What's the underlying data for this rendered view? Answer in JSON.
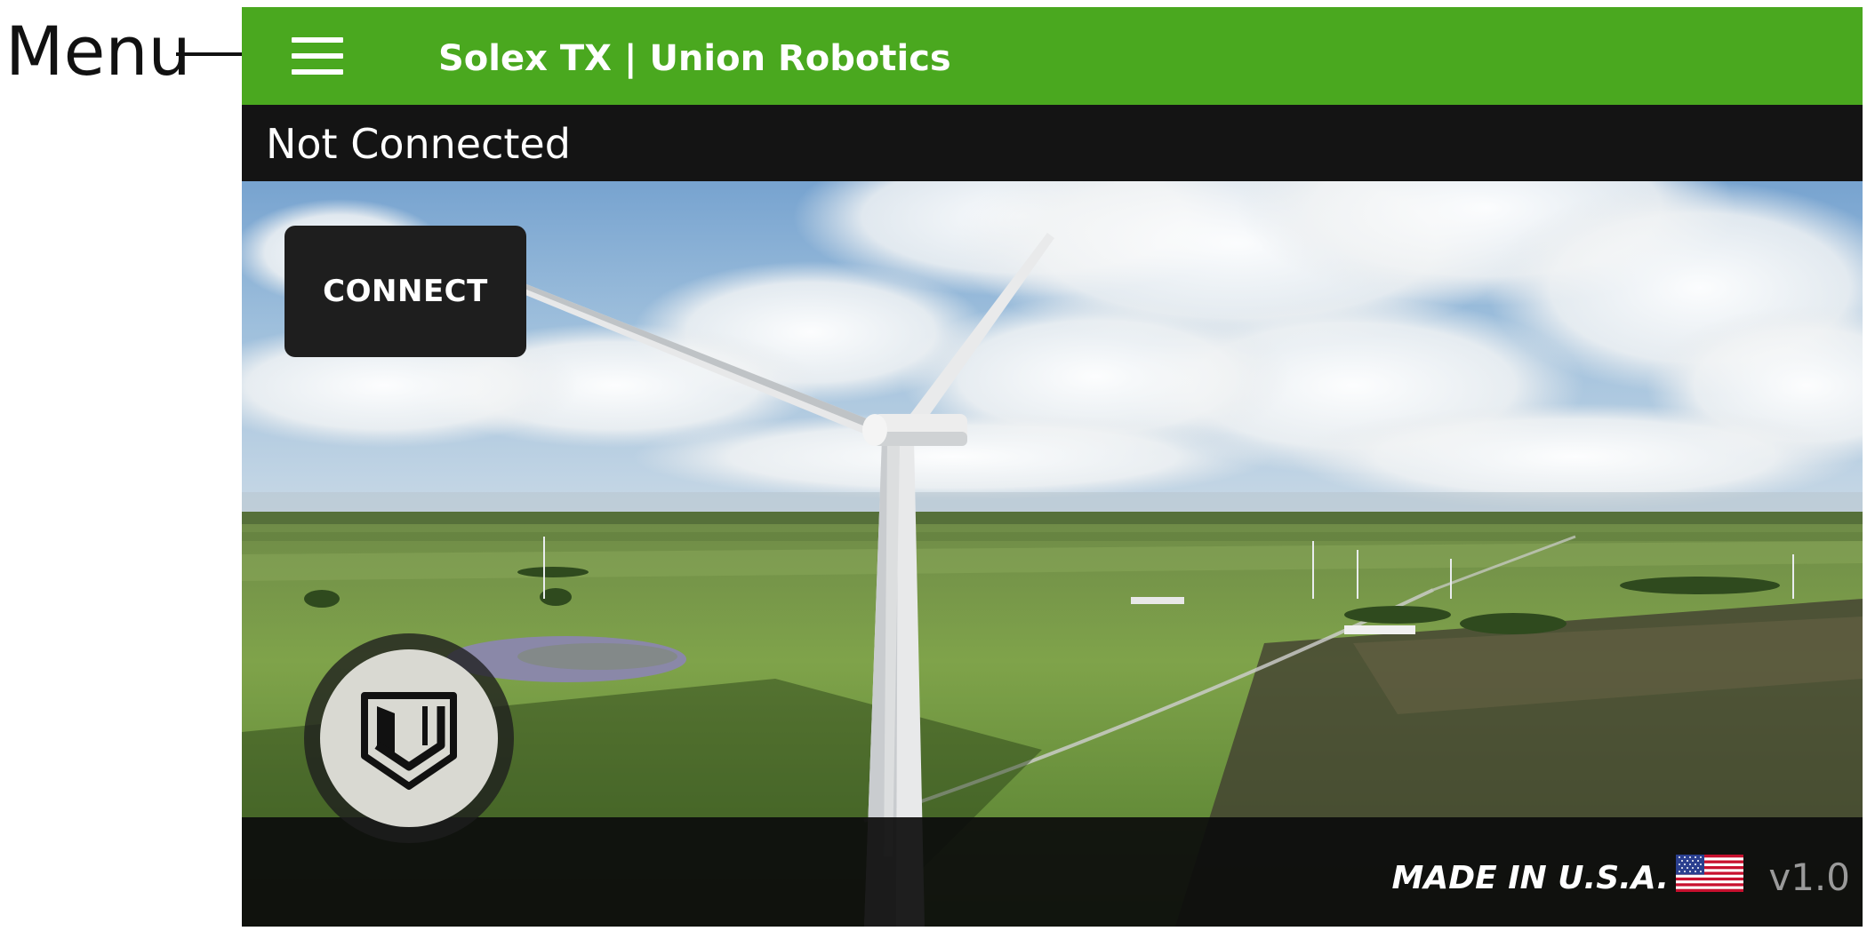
{
  "callout": {
    "label": "Menu"
  },
  "header": {
    "title": "Solex TX | Union Robotics",
    "menu_icon": "hamburger-menu-icon"
  },
  "status": {
    "text": "Not Connected"
  },
  "connect_button": {
    "label": "CONNECT"
  },
  "footer": {
    "made_in": "MADE IN U.S.A.",
    "flag_icon": "us-flag-icon",
    "version": "v1.0"
  },
  "logo": {
    "icon": "union-robotics-shield-logo"
  },
  "colors": {
    "header_green": "#4aa81f",
    "bar_dark": "#141414",
    "button_dark": "#1e1e1e"
  }
}
